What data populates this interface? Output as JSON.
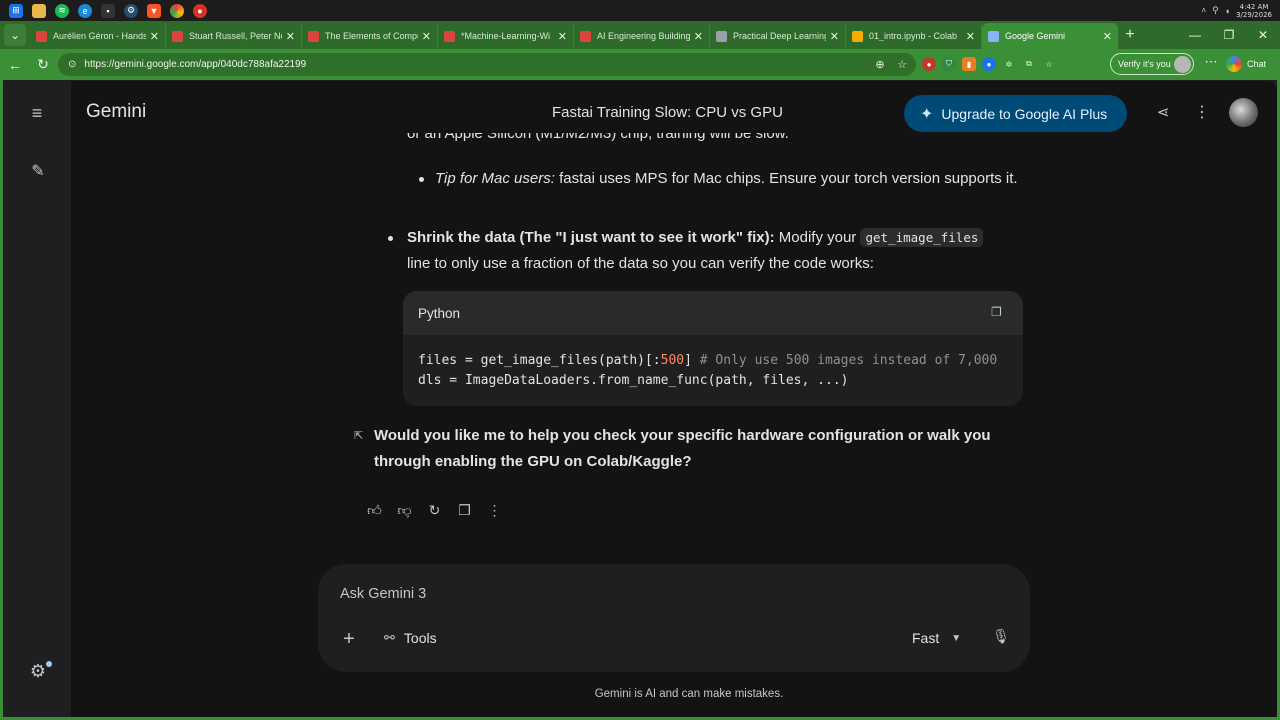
{
  "taskbar": {
    "icons": [
      "windows-icon",
      "folder-icon",
      "spotify-icon",
      "edge-icon",
      "terminal-icon",
      "steam-icon",
      "brave-icon",
      "chrome-icon",
      "app-icon"
    ],
    "clock_time": "4:42 AM",
    "clock_date": "3/29/2026"
  },
  "browser": {
    "tabs": [
      {
        "label": "Aurélien Géron - Hands",
        "favicon": "pdf-icon",
        "color": "#d9463f"
      },
      {
        "label": "Stuart Russell, Peter No",
        "favicon": "pdf-icon",
        "color": "#d9463f"
      },
      {
        "label": "The Elements of Compu",
        "favicon": "pdf-icon",
        "color": "#d9463f"
      },
      {
        "label": "*Machine-Learning-Wi",
        "favicon": "pdf-icon",
        "color": "#d9463f"
      },
      {
        "label": "AI Engineering Building",
        "favicon": "pdf-icon",
        "color": "#d9463f"
      },
      {
        "label": "Practical Deep Learning",
        "favicon": "globe-icon",
        "color": "#9aa0a6"
      },
      {
        "label": "01_intro.ipynb - Colab",
        "favicon": "colab-icon",
        "color": "#f9ab00"
      },
      {
        "label": "Google Gemini",
        "favicon": "gemini-icon",
        "color": "#8ab4f8"
      }
    ],
    "url": "https://gemini.google.com/app/040dc788afa22199",
    "verify_label": "Verify it's you",
    "chat_label": "Chat",
    "accent": "#3b8f36"
  },
  "app": {
    "brand": "Gemini",
    "conversation_title": "Fastai Training Slow: CPU vs GPU",
    "upgrade_label": "Upgrade to Google AI Plus",
    "cut_line": "or an Apple Silicon (M1/M2/M3) chip, training will be slow.",
    "tip": {
      "italic": "Tip for Mac users:",
      "rest": " fastai uses MPS for Mac chips. Ensure your torch version supports it."
    },
    "shrink": {
      "bold": "Shrink the data (The \"I just want to see it work\" fix):",
      "before_code": " Modify your ",
      "code": "get_image_files",
      "after_code": " line to only use a fraction of the data so you can verify the code works:"
    },
    "codeblock": {
      "language": "Python",
      "line1_a": "files = get_image_files(path)[:",
      "line1_num": "500",
      "line1_b": "] ",
      "line1_comment": "# Only use 500 images instead of 7,000",
      "line2": "dls = ImageDataLoaders.from_name_func(path, files, ...)"
    },
    "question": "Would you like me to help you check your specific hardware configuration or walk you through enabling the GPU on Colab/Kaggle?",
    "input_placeholder": "Ask Gemini 3",
    "tools_label": "Tools",
    "mode_label": "Fast",
    "disclaimer": "Gemini is AI and can make mistakes."
  }
}
